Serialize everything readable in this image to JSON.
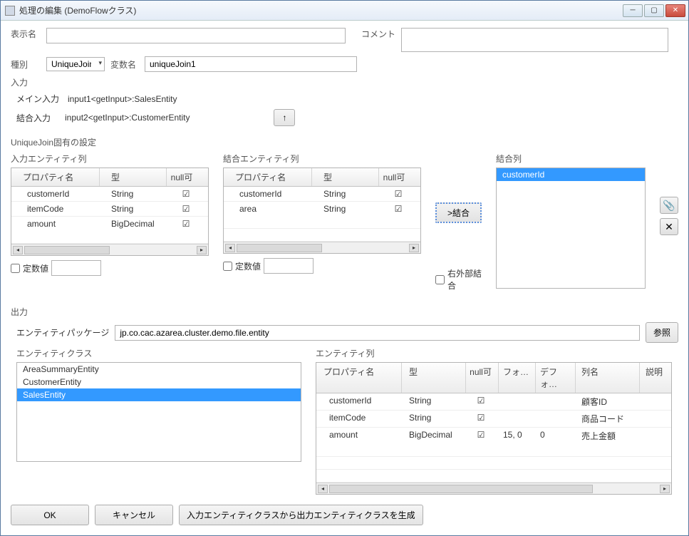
{
  "window": {
    "title": "処理の編集 (DemoFlowクラス)"
  },
  "labels": {
    "displayName": "表示名",
    "comment": "コメント",
    "type": "種別",
    "varName": "変数名",
    "input": "入力",
    "mainInput": "メイン入力",
    "joinInput": "結合入力",
    "settingsHeader": "UniqueJoin固有の設定",
    "inputEntityCol": "入力エンティティ列",
    "joinEntityCol": "結合エンティティ列",
    "joinCol": "結合列",
    "propName": "プロパティ名",
    "dtype": "型",
    "nullable": "null可",
    "constant": "定数値",
    "outerJoin": "右外部結合",
    "joinBtn": ">結合",
    "output": "出力",
    "entityPackage": "エンティティパッケージ",
    "browse": "参照",
    "entityClass": "エンティティクラス",
    "entityColumns": "エンティティ列",
    "format": "フォ…",
    "default": "デフォ…",
    "colName": "列名",
    "desc": "説明"
  },
  "fields": {
    "displayName": "",
    "comment": "",
    "type": "UniqueJoin",
    "varName": "uniqueJoin1",
    "mainInputValue": "input1<getInput>:SalesEntity",
    "joinInputValue": "input2<getInput>:CustomerEntity",
    "entityPackage": "jp.co.cac.azarea.cluster.demo.file.entity"
  },
  "inputGrid": [
    {
      "prop": "customerId",
      "type": "String",
      "nullable": true
    },
    {
      "prop": "itemCode",
      "type": "String",
      "nullable": true
    },
    {
      "prop": "amount",
      "type": "BigDecimal",
      "nullable": true
    }
  ],
  "joinGrid": [
    {
      "prop": "customerId",
      "type": "String",
      "nullable": true
    },
    {
      "prop": "area",
      "type": "String",
      "nullable": true
    }
  ],
  "joinColumns": [
    "customerId"
  ],
  "entityClasses": [
    {
      "name": "AreaSummaryEntity",
      "selected": false
    },
    {
      "name": "CustomerEntity",
      "selected": false
    },
    {
      "name": "SalesEntity",
      "selected": true
    }
  ],
  "outputGrid": [
    {
      "prop": "customerId",
      "type": "String",
      "nullable": true,
      "format": "",
      "default": "",
      "colName": "顧客ID"
    },
    {
      "prop": "itemCode",
      "type": "String",
      "nullable": true,
      "format": "",
      "default": "",
      "colName": "商品コード"
    },
    {
      "prop": "amount",
      "type": "BigDecimal",
      "nullable": true,
      "format": "15, 0",
      "default": "0",
      "colName": "売上金額"
    }
  ],
  "buttons": {
    "ok": "OK",
    "cancel": "キャンセル",
    "generate": "入力エンティティクラスから出力エンティティクラスを生成"
  }
}
